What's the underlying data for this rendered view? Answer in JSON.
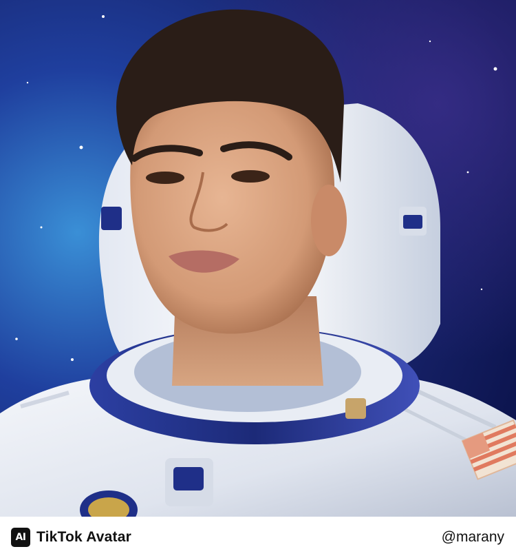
{
  "artwork": {
    "subject": "astronaut-portrait",
    "colors": {
      "space_deep": "#0d1550",
      "space_mid": "#1f3f9e",
      "space_glow": "#3a8fd6",
      "suit_white": "#eef1f6",
      "suit_shadow": "#b9c1d2",
      "helmet_ring": "#1c2a78",
      "skin": "#d9a27e",
      "hair": "#2a1d17"
    }
  },
  "footer": {
    "badge_text": "AI",
    "brand_name": "TikTok Avatar",
    "user_handle": "@marany"
  }
}
